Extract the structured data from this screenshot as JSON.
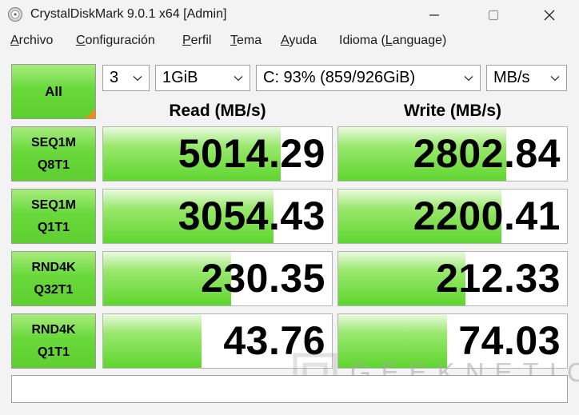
{
  "window": {
    "title": "CrystalDiskMark 9.0.1 x64 [Admin]",
    "icons": {
      "app": "crystaldiskmark-app-icon",
      "minimize": "minimize-icon",
      "maximize": "maximize-icon",
      "close": "close-icon"
    }
  },
  "menu": [
    {
      "key": "A",
      "rest": "rchivo"
    },
    {
      "key": "C",
      "rest": "onfiguración"
    },
    {
      "key": "P",
      "rest": "erfil"
    },
    {
      "key": "T",
      "rest": "ema"
    },
    {
      "key": "A",
      "rest": "yuda"
    },
    {
      "pre": "Idioma (",
      "key": "L",
      "rest": "anguage)"
    }
  ],
  "controls": {
    "all_label": "All",
    "test_count": "3",
    "test_size": "1GiB",
    "drive": "C: 93% (859/926GiB)",
    "unit": "MB/s"
  },
  "headers": {
    "read": "Read (MB/s)",
    "write": "Write (MB/s)"
  },
  "tests": [
    {
      "line1": "SEQ1M",
      "line2": "Q8T1",
      "read": "5014.29",
      "write": "2802.84",
      "read_fill": 0.775,
      "write_fill": 0.735
    },
    {
      "line1": "SEQ1M",
      "line2": "Q1T1",
      "read": "3054.43",
      "write": "2200.41",
      "read_fill": 0.745,
      "write_fill": 0.715
    },
    {
      "line1": "RND4K",
      "line2": "Q32T1",
      "read": "230.35",
      "write": "212.33",
      "read_fill": 0.56,
      "write_fill": 0.555
    },
    {
      "line1": "RND4K",
      "line2": "Q1T1",
      "read": "43.76",
      "write": "74.03",
      "read_fill": 0.43,
      "write_fill": 0.475
    }
  ],
  "status_text": "",
  "watermark": "GEEKNETIC",
  "colors": {
    "bar_green": "#5fd52f",
    "button_green": "#68d83a",
    "corner_orange": "#f28a1c"
  }
}
